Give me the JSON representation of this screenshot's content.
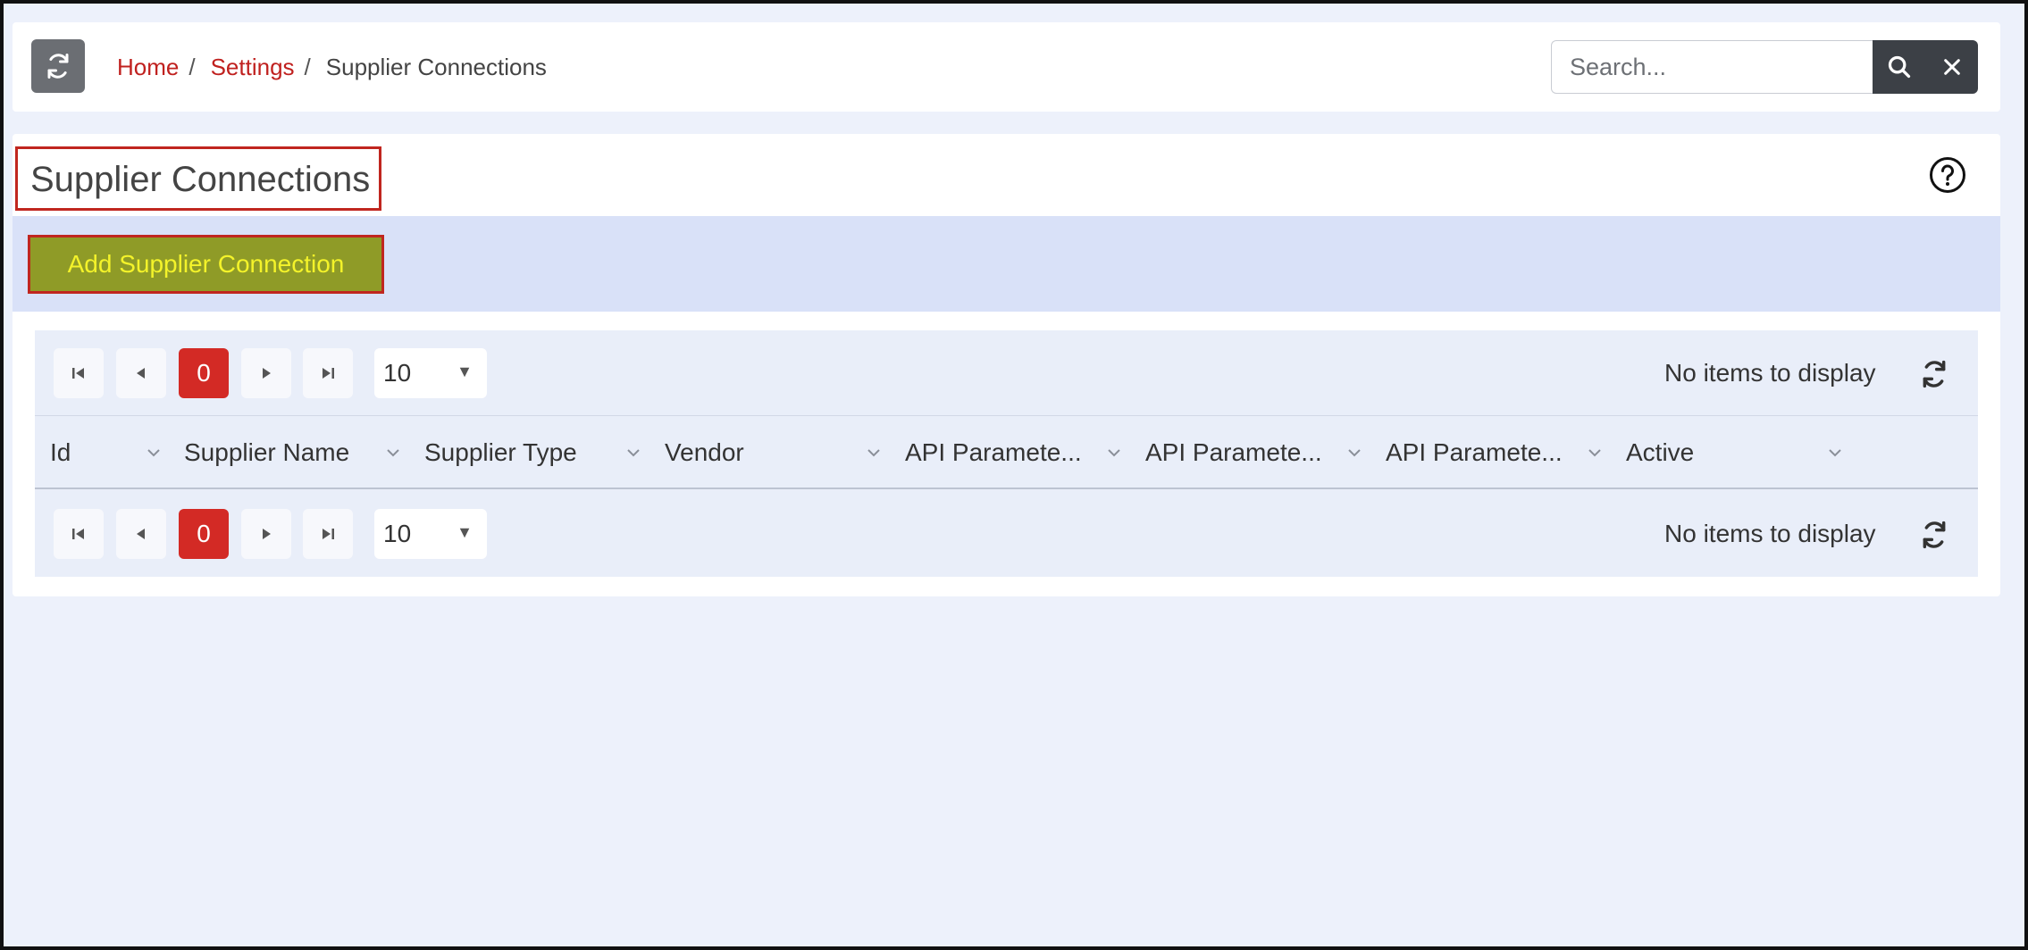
{
  "breadcrumb": {
    "home": "Home",
    "settings": "Settings",
    "current": "Supplier Connections",
    "separator": "/"
  },
  "search": {
    "placeholder": "Search..."
  },
  "page": {
    "title": "Supplier Connections",
    "add_button": "Add Supplier Connection"
  },
  "grid": {
    "columns": [
      "Id",
      "Supplier Name",
      "Supplier Type",
      "Vendor",
      "API Paramete...",
      "API Paramete...",
      "API Paramete...",
      "Active"
    ],
    "pager": {
      "current_page": "0",
      "page_size": "10",
      "status": "No items to display"
    }
  },
  "colors": {
    "accent_red": "#c0211f",
    "add_button_bg": "#8f9b27",
    "add_button_text": "#f4f32a",
    "band": "#d9e1f8"
  },
  "icons": [
    "refresh-icon",
    "search-icon",
    "close-icon",
    "help-icon",
    "first-page-icon",
    "prev-page-icon",
    "next-page-icon",
    "last-page-icon",
    "chevron-down-icon"
  ]
}
